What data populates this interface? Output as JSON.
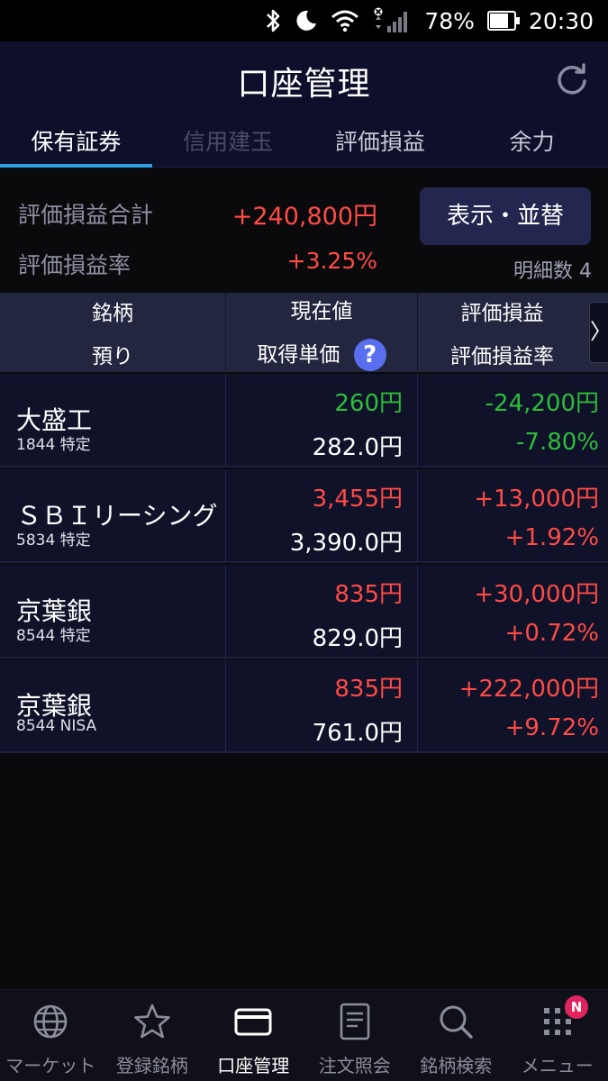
{
  "status_bar": {
    "battery": "78%",
    "time": "20:30",
    "icons": [
      "bluetooth-icon",
      "moon-icon",
      "wifi-icon",
      "signal-icon",
      "battery-icon"
    ]
  },
  "header": {
    "title": "口座管理",
    "refresh_icon": "refresh-icon"
  },
  "tabs": [
    {
      "label": "保有証券",
      "state": "active"
    },
    {
      "label": "信用建玉",
      "state": "disabled"
    },
    {
      "label": "評価損益",
      "state": "normal"
    },
    {
      "label": "余力",
      "state": "normal"
    }
  ],
  "summary": {
    "total_label": "評価損益合計",
    "total_value": "+240,800円",
    "rate_label": "評価損益率",
    "rate_value": "+3.25%",
    "display_button": "表示・並替",
    "count_label": "明細数",
    "count": "4"
  },
  "table": {
    "headers": {
      "col1_top": "銘柄",
      "col1_bottom": "預り",
      "col2_top": "現在値",
      "col2_bottom": "取得単価",
      "col3_top": "評価損益",
      "col3_bottom": "評価損益率",
      "help": "?",
      "next": "〉"
    },
    "rows": [
      {
        "name": "大盛工",
        "code": "1844 特定",
        "price": "260円",
        "cost": "282.0円",
        "pl": "-24,200円",
        "plr": "-7.80%",
        "color": "green"
      },
      {
        "name": "ＳＢＩリーシング",
        "code": "5834 特定",
        "price": "3,455円",
        "cost": "3,390.0円",
        "pl": "+13,000円",
        "plr": "+1.92%",
        "color": "red"
      },
      {
        "name": "京葉銀",
        "code": "8544 特定",
        "price": "835円",
        "cost": "829.0円",
        "pl": "+30,000円",
        "plr": "+0.72%",
        "color": "red"
      },
      {
        "name": "京葉銀",
        "code": "8544 NISA",
        "price": "835円",
        "cost": "761.0円",
        "pl": "+222,000円",
        "plr": "+9.72%",
        "color": "red"
      }
    ]
  },
  "bottom_nav": [
    {
      "label": "マーケット",
      "icon": "globe-icon",
      "active": false
    },
    {
      "label": "登録銘柄",
      "icon": "star-icon",
      "active": false
    },
    {
      "label": "口座管理",
      "icon": "card-icon",
      "active": true
    },
    {
      "label": "注文照会",
      "icon": "document-icon",
      "active": false
    },
    {
      "label": "銘柄検索",
      "icon": "search-icon",
      "active": false
    },
    {
      "label": "メニュー",
      "icon": "grid-icon",
      "active": false,
      "badge": "N"
    }
  ],
  "colors": {
    "header_bg": "#0e0f2a",
    "tab_indicator": "#2c9fe0",
    "positive": "#ff4b45",
    "negative": "#2ebd3a",
    "button_bg": "#23264e"
  }
}
